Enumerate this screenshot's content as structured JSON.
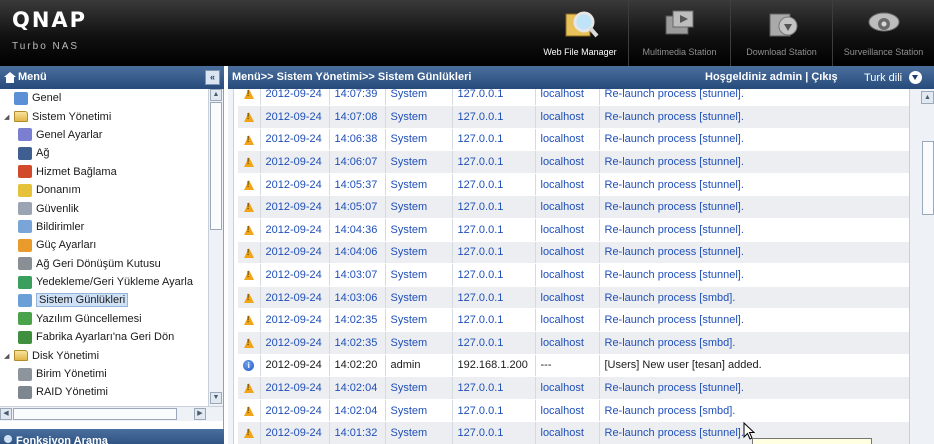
{
  "header": {
    "logo": "QNAP",
    "subtitle": "Turbo NAS",
    "apps": [
      {
        "label": "Web File Manager",
        "icon": "web-file-manager-icon",
        "active": true
      },
      {
        "label": "Multimedia Station",
        "icon": "multimedia-station-icon",
        "active": false
      },
      {
        "label": "Download Station",
        "icon": "download-station-icon",
        "active": false
      },
      {
        "label": "Surveillance Station",
        "icon": "surveillance-station-icon",
        "active": false
      }
    ]
  },
  "sidebar": {
    "title": "Menü",
    "collapse": "«",
    "items": [
      {
        "label": "Genel",
        "level": 1,
        "icon": "general-icon"
      },
      {
        "label": "Sistem Yönetimi",
        "level": 1,
        "icon": "folder-icon",
        "expanded": true
      },
      {
        "label": "Genel Ayarlar",
        "level": 2,
        "icon": "general-settings-icon"
      },
      {
        "label": "Ağ",
        "level": 2,
        "icon": "network-icon"
      },
      {
        "label": "Hizmet Bağlama",
        "level": 2,
        "icon": "service-binding-icon"
      },
      {
        "label": "Donanım",
        "level": 2,
        "icon": "hardware-icon"
      },
      {
        "label": "Güvenlik",
        "level": 2,
        "icon": "security-icon"
      },
      {
        "label": "Bildirimler",
        "level": 2,
        "icon": "notification-icon"
      },
      {
        "label": "Güç Ayarları",
        "level": 2,
        "icon": "power-icon"
      },
      {
        "label": "Ağ Geri Dönüşüm Kutusu",
        "level": 2,
        "icon": "recycle-bin-icon"
      },
      {
        "label": "Yedekleme/Geri Yükleme Ayarla",
        "level": 2,
        "icon": "backup-icon"
      },
      {
        "label": "Sistem Günlükleri",
        "level": 2,
        "icon": "system-logs-icon",
        "selected": true
      },
      {
        "label": "Yazılım Güncellemesi",
        "level": 2,
        "icon": "firmware-update-icon"
      },
      {
        "label": "Fabrika Ayarları'na Geri Dön",
        "level": 2,
        "icon": "factory-reset-icon"
      },
      {
        "label": "Disk Yönetimi",
        "level": 1,
        "icon": "folder-icon",
        "expanded": true
      },
      {
        "label": "Birim Yönetimi",
        "level": 2,
        "icon": "volume-icon"
      },
      {
        "label": "RAID Yönetimi",
        "level": 2,
        "icon": "raid-icon"
      }
    ],
    "function_search": "Fonksiyon Arama"
  },
  "topbar": {
    "breadcrumb": "Menü>> Sistem Yönetimi>> Sistem Günlükleri",
    "welcome": "Hoşgeldiniz admin | Çıkış",
    "language": "Turk dili"
  },
  "logs": {
    "rows": [
      {
        "type": "warning",
        "date": "2012-09-24",
        "time": "14:07:39",
        "user": "System",
        "ip": "127.0.0.1",
        "host": "localhost",
        "content": "Re-launch process [stunnel]."
      },
      {
        "type": "warning",
        "date": "2012-09-24",
        "time": "14:07:08",
        "user": "System",
        "ip": "127.0.0.1",
        "host": "localhost",
        "content": "Re-launch process [stunnel]."
      },
      {
        "type": "warning",
        "date": "2012-09-24",
        "time": "14:06:38",
        "user": "System",
        "ip": "127.0.0.1",
        "host": "localhost",
        "content": "Re-launch process [stunnel]."
      },
      {
        "type": "warning",
        "date": "2012-09-24",
        "time": "14:06:07",
        "user": "System",
        "ip": "127.0.0.1",
        "host": "localhost",
        "content": "Re-launch process [stunnel]."
      },
      {
        "type": "warning",
        "date": "2012-09-24",
        "time": "14:05:37",
        "user": "System",
        "ip": "127.0.0.1",
        "host": "localhost",
        "content": "Re-launch process [stunnel]."
      },
      {
        "type": "warning",
        "date": "2012-09-24",
        "time": "14:05:07",
        "user": "System",
        "ip": "127.0.0.1",
        "host": "localhost",
        "content": "Re-launch process [stunnel]."
      },
      {
        "type": "warning",
        "date": "2012-09-24",
        "time": "14:04:36",
        "user": "System",
        "ip": "127.0.0.1",
        "host": "localhost",
        "content": "Re-launch process [stunnel]."
      },
      {
        "type": "warning",
        "date": "2012-09-24",
        "time": "14:04:06",
        "user": "System",
        "ip": "127.0.0.1",
        "host": "localhost",
        "content": "Re-launch process [stunnel]."
      },
      {
        "type": "warning",
        "date": "2012-09-24",
        "time": "14:03:07",
        "user": "System",
        "ip": "127.0.0.1",
        "host": "localhost",
        "content": "Re-launch process [stunnel]."
      },
      {
        "type": "warning",
        "date": "2012-09-24",
        "time": "14:03:06",
        "user": "System",
        "ip": "127.0.0.1",
        "host": "localhost",
        "content": "Re-launch process [smbd]."
      },
      {
        "type": "warning",
        "date": "2012-09-24",
        "time": "14:02:35",
        "user": "System",
        "ip": "127.0.0.1",
        "host": "localhost",
        "content": "Re-launch process [stunnel]."
      },
      {
        "type": "warning",
        "date": "2012-09-24",
        "time": "14:02:35",
        "user": "System",
        "ip": "127.0.0.1",
        "host": "localhost",
        "content": "Re-launch process [smbd]."
      },
      {
        "type": "info",
        "date": "2012-09-24",
        "time": "14:02:20",
        "user": "admin",
        "ip": "192.168.1.200",
        "host": "---",
        "content": "[Users] New user [tesan] added."
      },
      {
        "type": "warning",
        "date": "2012-09-24",
        "time": "14:02:04",
        "user": "System",
        "ip": "127.0.0.1",
        "host": "localhost",
        "content": "Re-launch process [stunnel]."
      },
      {
        "type": "warning",
        "date": "2012-09-24",
        "time": "14:02:04",
        "user": "System",
        "ip": "127.0.0.1",
        "host": "localhost",
        "content": "Re-launch process [smbd]."
      },
      {
        "type": "warning",
        "date": "2012-09-24",
        "time": "14:01:32",
        "user": "System",
        "ip": "127.0.0.1",
        "host": "localhost",
        "content": "Re-launch process [stunnel]."
      }
    ]
  },
  "colors": {
    "header_bg": "#000000",
    "bar_blue": "#264a7a",
    "link_blue": "#1f4fb8",
    "selected_bg": "#cfe1f6",
    "warning": "#f0a417",
    "info": "#1f56c8"
  }
}
